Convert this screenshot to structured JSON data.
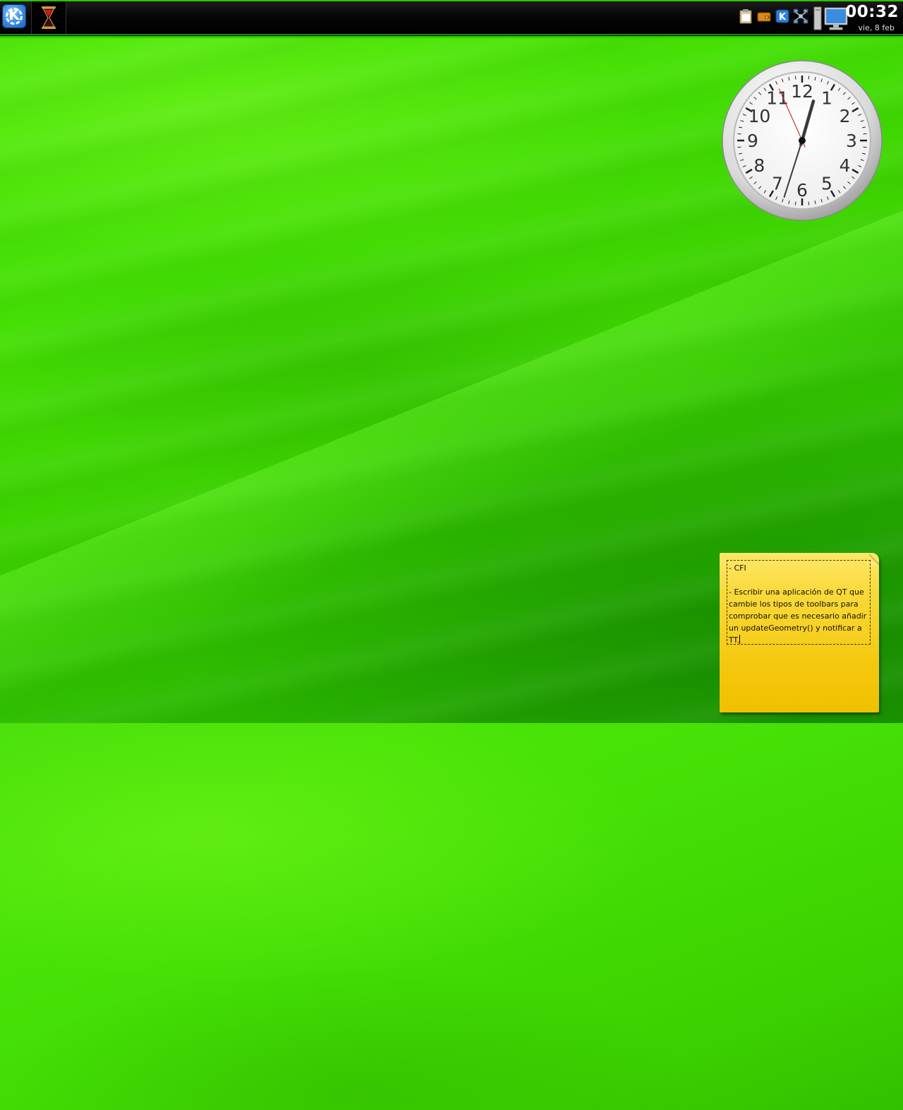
{
  "panel": {
    "kmenu_icon": "kde-k-menu-icon",
    "task": {
      "icon": "hourglass-icon"
    },
    "tray_icons": [
      "klipper-clipboard-icon",
      "kwallet-icon",
      "kde-update-icon",
      "network-icon",
      "computer-monitor-icon"
    ],
    "clock": {
      "time": "00:32",
      "date": "vie, 8 feb"
    }
  },
  "analog_clock": {
    "numerals": [
      "12",
      "1",
      "2",
      "3",
      "4",
      "5",
      "6",
      "7",
      "8",
      "9",
      "10",
      "11"
    ],
    "hour": 0,
    "minute": 32,
    "second": 56
  },
  "note": {
    "text": "- CFI\n\n- Escribir una aplicación de QT que cambie los tipos de toolbars para comprobar que es necesario añadir un updateGeometry() y notificar a TT."
  },
  "colors": {
    "panel_border": "#2fd000",
    "desktop_green": "#3bd000",
    "note_yellow": "#f4c80e"
  }
}
